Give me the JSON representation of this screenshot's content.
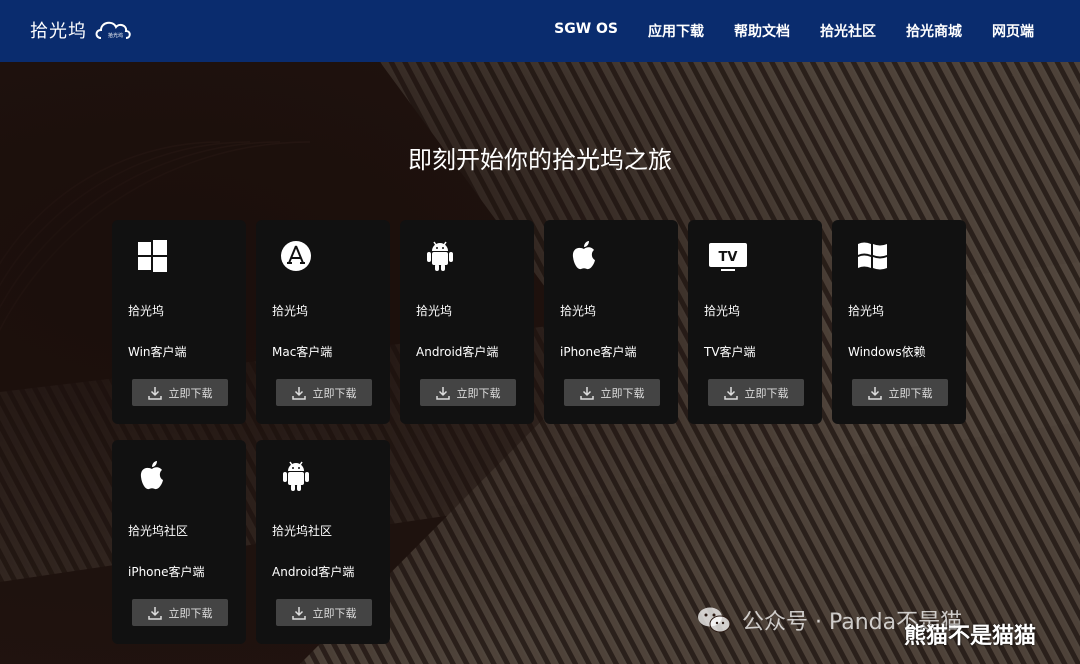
{
  "header": {
    "logo_text": "拾光坞",
    "logo_cloud_text": "拾光坞",
    "nav": [
      "SGW OS",
      "应用下载",
      "帮助文档",
      "拾光社区",
      "拾光商城",
      "网页端"
    ]
  },
  "hero": {
    "title": "即刻开始你的拾光坞之旅"
  },
  "cards": [
    {
      "icon": "windows-icon",
      "name": "拾光坞",
      "sub": "Win客户端",
      "button": "立即下载"
    },
    {
      "icon": "app-store-icon",
      "name": "拾光坞",
      "sub": "Mac客户端",
      "button": "立即下载"
    },
    {
      "icon": "android-icon",
      "name": "拾光坞",
      "sub": "Android客户端",
      "button": "立即下载"
    },
    {
      "icon": "apple-icon",
      "name": "拾光坞",
      "sub": "iPhone客户端",
      "button": "立即下载"
    },
    {
      "icon": "tv-icon",
      "name": "拾光坞",
      "sub": "TV客户端",
      "button": "立即下载"
    },
    {
      "icon": "windows-flag-icon",
      "name": "拾光坞",
      "sub": "Windows依赖",
      "button": "立即下载"
    },
    {
      "icon": "apple-icon",
      "name": "拾光坞社区",
      "sub": "iPhone客户端",
      "button": "立即下载"
    },
    {
      "icon": "android-icon",
      "name": "拾光坞社区",
      "sub": "Android客户端",
      "button": "立即下载"
    }
  ],
  "watermark": {
    "icon": "wechat-icon",
    "text": "公众号 · Panda不是猫",
    "author": "熊猫不是猫猫"
  },
  "colors": {
    "header_bg": "#0a2c6e",
    "card_bg": "#111111",
    "button_bg": "#444444"
  }
}
